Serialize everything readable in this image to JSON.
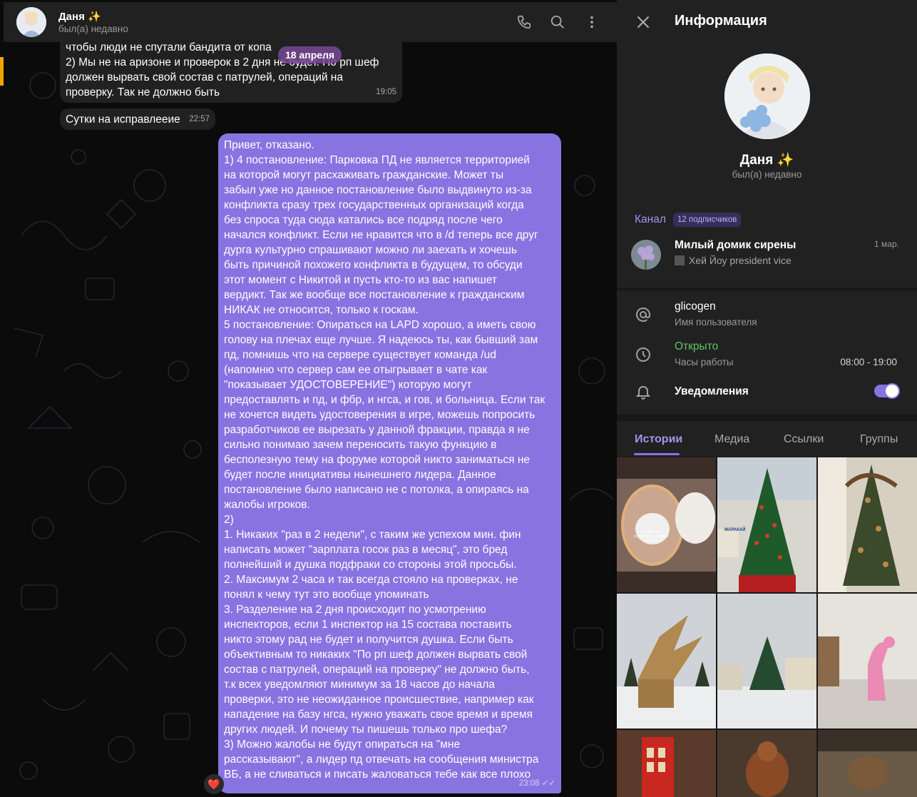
{
  "chat": {
    "name": "Даня ✨",
    "status": "был(а) недавно",
    "date_chip": "18 апреля",
    "incoming_1": {
      "text": "чтобы люди не спутали бандита от копа\n2) Мы не на аризоне и проверок в 2 дня не будет. По рп шеф\nдолжен вырвать свой состав с патрулей, операций на\nпроверку. Так не должно быть",
      "time": "19:05"
    },
    "incoming_2": {
      "text": "Сутки на исправлееие",
      "time": "22:57"
    },
    "outgoing": {
      "text": "Привет, отказано.\n1) 4 постановление: Парковка ПД не является территорией\nна которой могут расхаживать гражданские. Может ты\nзабыл уже но данное постановление было выдвинуто из-за\nконфликта сразу трех государственных организаций когда\nбез спроса туда сюда катались все подряд после чего\nначался конфликт. Если не нравится что в /d теперь все друг\nдурга культурно спрашивают можно ли заехать и хочешь\nбыть причиной похожего конфликта в будущем, то обсуди\nэтот момент с Никитой и пусть кто-то из вас напишет\nвердикт. Так же вообще все постановление к гражданским\nНИКАК не относится, только к госкам.\n5 постановление: Опираться на LAPD хорошо, а иметь свою\nголову на плечах еще лучше. Я надеюсь ты, как бывший зам\nпд, помнишь что на сервере существует команда /ud\n(напомню что сервер сам ее отыгрывает в чате как\n\"показывает УДОСТОВЕРЕНИЕ\") которую могут\nпредоставлять и пд, и фбр, и нгса, и гов, и больница. Если так\nне хочется видеть удостоверения в игре, можешь попросить\nразработчиков ее вырезать у данной фракции, правда я не\nсильно понимаю зачем переносить такую функцию в\nбесполезную тему на форуме которой никто заниматься не\nбудет после инициативы нынешнего лидера. Данное\nпостановление было написано не с потолка, а опираясь на\nжалобы игроков.\n2)\n1. Никаких \"раз в 2 недели\", с таким же успехом мин. фин\nнаписать может \"зарплата госок раз в месяц\", это бред\nполнейший и душка подфраки со стороны этой просьбы.\n2. Максимум 2 часа и так всегда стояло на проверках, не\nпонял к чему тут это вообще упоминать\n3. Разделение на 2 дня происходит по усмотрению\nинспекторов, если 1 инспектор на 15 состава поставить\nникто этому рад не будет и получится душка. Если быть\nобъективным то никаких \"По рп шеф должен вырвать свой\nсостав с патрулей, операций на проверку\" не должно быть,\nт.к всех уведомляют минимум за 18 часов до начала\nпроверки, это не неожиданное происшествие, например как\nнападение на базу нгса, нужно уважать свое время и время\nдругих людей. И почему ты пишешь только про шефа?\n3) Можно жалобы не будут опираться на \"мне\nрассказывают\", а лидер пд отвечать на сообщения министра\nВБ, а не сливаться и писать жаловаться тебе как все плохо",
      "time": "23:08"
    },
    "reaction": "❤️",
    "icons": [
      "phone-icon",
      "search-icon",
      "more-vertical-icon"
    ]
  },
  "info": {
    "title": "Информация",
    "name": "Даня ✨",
    "status": "был(а) недавно",
    "channel": {
      "label": "Канал",
      "subscribers": "12 подписчиков",
      "name": "Милый домик сирены",
      "date": "1 мар.",
      "last_message": "Хей Йоу president vice"
    },
    "username": {
      "value": "glicogen",
      "label": "Имя пользователя"
    },
    "work_hours": {
      "status": "Открыто",
      "label": "Часы работы",
      "value": "08:00 - 19:00"
    },
    "notifications": {
      "label": "Уведомления",
      "enabled": true
    },
    "tabs": [
      "Истории",
      "Медиа",
      "Ссылки",
      "Группы"
    ],
    "active_tab": "Истории",
    "story_captions": [
      "у тебя такое\nотражение в зеркале\nусилий",
      "МАРАКАЙ"
    ]
  },
  "colors": {
    "accent": "#8774e1",
    "open_status": "#5fc45f",
    "panel": "#212121",
    "outgoing_bubble": "#8774e1"
  }
}
